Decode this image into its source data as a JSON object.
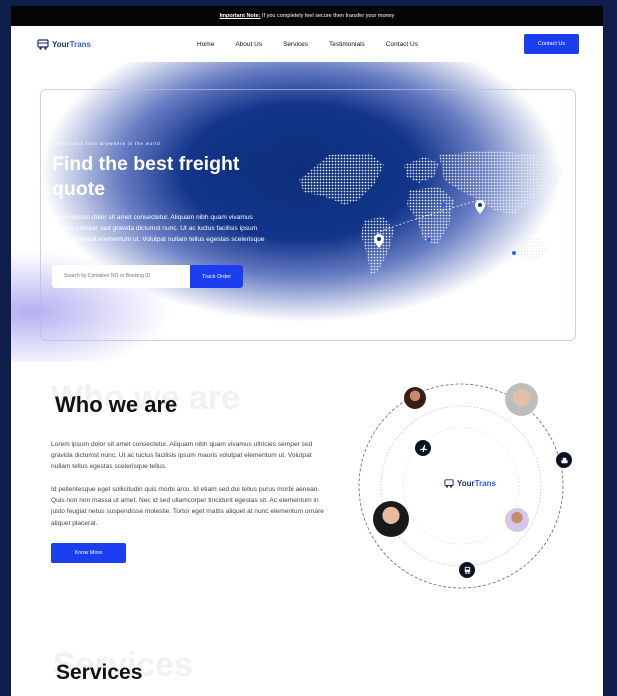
{
  "topbar": {
    "note_label": "Important Note:",
    "note_text": " If you completely feel secure then transfer your money"
  },
  "brand": {
    "part1": "Your",
    "part2": "Trans"
  },
  "nav": {
    "items": [
      "Home",
      "About Us",
      "Services",
      "Testimonials",
      "Contact Us"
    ],
    "cta": "Contact Us"
  },
  "hero": {
    "kicker": "Ship to and from anywhere in the world",
    "title": "Find the best freight quote",
    "lead": "Lorem ipsum dolor sit amet consectetur. Aliquam nibh quam vivamus ultricies semper sed gravida dictumst nunc. Ut ac luctus facilisis ipsum mauris volutpat elementum ut. Volutpat nullam tellus egestas scelerisque tellus",
    "search_placeholder": "Search by Container NO or Booking ID",
    "track_label": "Track Order"
  },
  "who": {
    "ghost": "Who we are",
    "title": "Who we are",
    "p1": "Lorem ipsum dolor sit amet consectetur. Aliquam nibh quam vivamus ultricies semper sed gravida dictumst nunc. Ut ac luctus facilisis ipsum mauris volutpat elementum ut. Volutpat nullam tellus egestas scelerisque tellus.",
    "p2": "Id pellentesque eget sollicitudin quis morbi arcu. Id etiam sed dui tellus purus morbi aenean. Quis non non massa ut amet. Nec id sed ullamcorper tincidunt egestas sit. Ac elementum in justo feugiat netus suspendisse molestie. Tortor eget mattis aliquet at nunc elementum ornare aliquet placerat.",
    "button": "Know More"
  },
  "services": {
    "ghost": "Services",
    "title": "Services"
  },
  "colors": {
    "accent": "#1b3ef1",
    "dark": "#0f1d4a",
    "hero": "#12348a"
  }
}
